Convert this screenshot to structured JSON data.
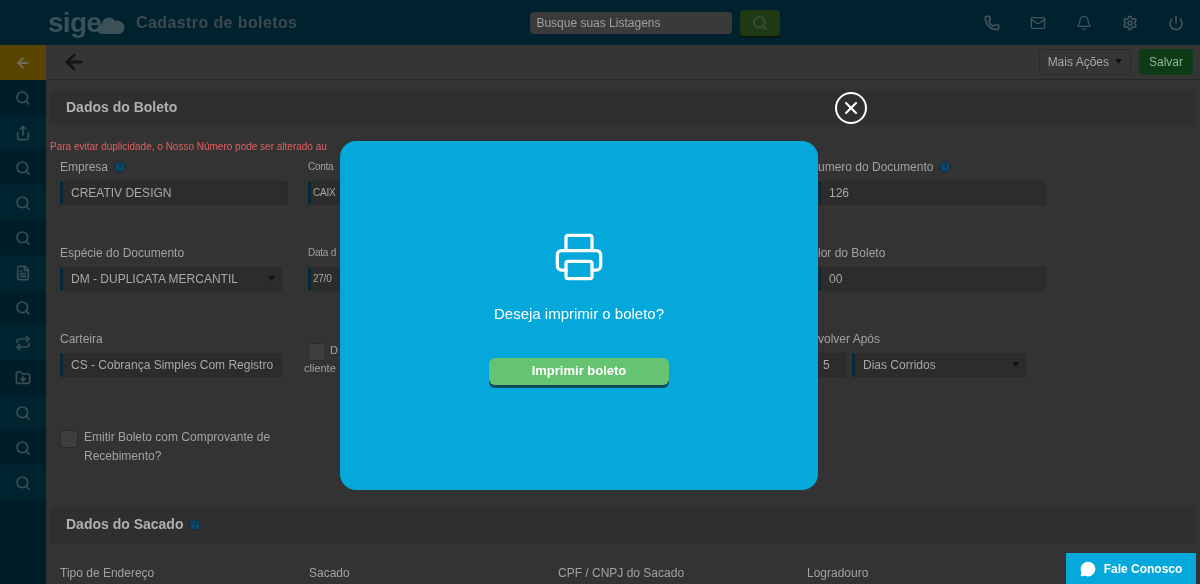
{
  "topbar": {
    "logo": "sige",
    "title": "Cadastro de boletos",
    "search": {
      "placeholder": "Busque suas Listagens"
    }
  },
  "toolbar": {
    "more_actions": "Mais Ações",
    "save": "Salvar"
  },
  "boleto_section": {
    "title": "Dados do Boleto",
    "notice": "Para evitar duplicidade, o Nosso Número pode ser alterado au",
    "rows": [
      {
        "column_1": {
          "kind": "text",
          "label": "Empresa",
          "help": true,
          "value": "CREATIV DESIGN"
        },
        "column_2": {
          "kind": "text",
          "label": "Conta",
          "value": "CAIX"
        },
        "column_4": {
          "kind": "text",
          "label": "umero do Documento",
          "help": true,
          "value": "126"
        }
      },
      {
        "column_1": {
          "kind": "select",
          "label": "Espécie do Documento",
          "value": "DM - DUPLICATA MERCANTIL"
        },
        "column_2": {
          "kind": "text",
          "label": "Data d",
          "value": "27/0"
        },
        "column_4": {
          "kind": "text",
          "label": "lor do Boleto",
          "value": "00"
        }
      },
      {
        "column_1": {
          "kind": "select",
          "label": "Carteira",
          "value": "CS - Cobrança Simples Com Registro"
        },
        "column_2": {
          "kind": "checkbox",
          "label": "D",
          "note": "cliente",
          "checked": false
        },
        "column_4": {
          "kind": "split",
          "label": "volver Após",
          "value": "5",
          "unit": "Dias Corridos"
        }
      },
      {
        "column_1": {
          "kind": "checkbox",
          "label": "Emitir Boleto com Comprovante de Recebimento?",
          "checked": false
        }
      }
    ]
  },
  "sacado_section": {
    "title": "Dados do Sacado",
    "help": true,
    "labels": [
      "Tipo de Endereço",
      "Sacado",
      "CPF / CNPJ do Sacado",
      "Logradouro"
    ]
  },
  "modal": {
    "question": "Deseja imprimir o boleto?",
    "button": "Imprimir boleto"
  },
  "chat_button": "Fale Conosco"
}
